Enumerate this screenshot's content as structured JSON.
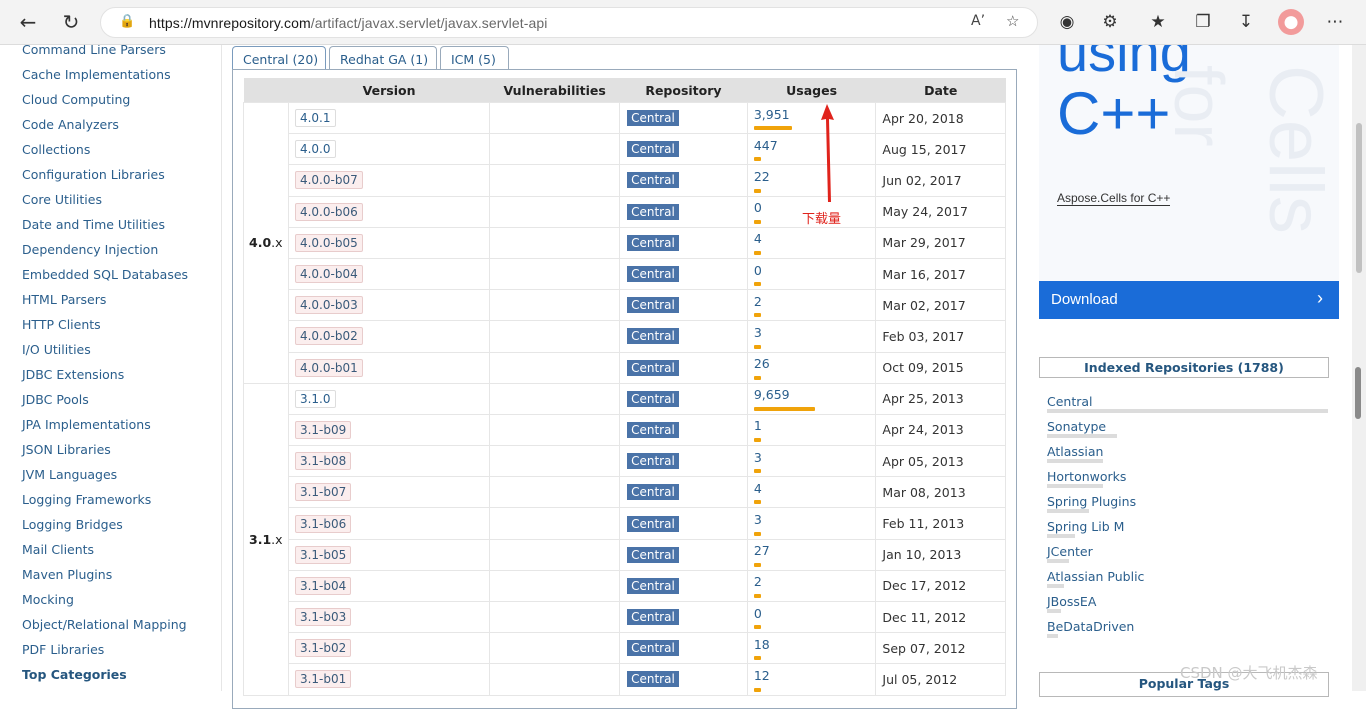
{
  "browser": {
    "url_host": "https://mvnrepository.com",
    "url_path": "/artifact/javax.servlet/javax.servlet-api"
  },
  "categories": [
    "Command Line Parsers",
    "Cache Implementations",
    "Cloud Computing",
    "Code Analyzers",
    "Collections",
    "Configuration Libraries",
    "Core Utilities",
    "Date and Time Utilities",
    "Dependency Injection",
    "Embedded SQL Databases",
    "HTML Parsers",
    "HTTP Clients",
    "I/O Utilities",
    "JDBC Extensions",
    "JDBC Pools",
    "JPA Implementations",
    "JSON Libraries",
    "JVM Languages",
    "Logging Frameworks",
    "Logging Bridges",
    "Mail Clients",
    "Maven Plugins",
    "Mocking",
    "Object/Relational Mapping",
    "PDF Libraries"
  ],
  "top_categories_label": "Top Categories",
  "tabs": [
    "Central (20)",
    "Redhat GA (1)",
    "ICM (5)"
  ],
  "table": {
    "headers": [
      "Version",
      "Vulnerabilities",
      "Repository",
      "Usages",
      "Date"
    ],
    "groups": [
      {
        "label_bold": "4.0",
        "label_rest": ".x",
        "rows": [
          {
            "version": "4.0.1",
            "pre": false,
            "repo": "Central",
            "usages": "3,951",
            "usage_frac": 0.32,
            "date": "Apr 20, 2018"
          },
          {
            "version": "4.0.0",
            "pre": false,
            "repo": "Central",
            "usages": "447",
            "usage_frac": 0.06,
            "date": "Aug 15, 2017"
          },
          {
            "version": "4.0.0-b07",
            "pre": true,
            "repo": "Central",
            "usages": "22",
            "usage_frac": 0.05,
            "date": "Jun 02, 2017"
          },
          {
            "version": "4.0.0-b06",
            "pre": true,
            "repo": "Central",
            "usages": "0",
            "usage_frac": 0.05,
            "date": "May 24, 2017"
          },
          {
            "version": "4.0.0-b05",
            "pre": true,
            "repo": "Central",
            "usages": "4",
            "usage_frac": 0.05,
            "date": "Mar 29, 2017"
          },
          {
            "version": "4.0.0-b04",
            "pre": true,
            "repo": "Central",
            "usages": "0",
            "usage_frac": 0.05,
            "date": "Mar 16, 2017"
          },
          {
            "version": "4.0.0-b03",
            "pre": true,
            "repo": "Central",
            "usages": "2",
            "usage_frac": 0.05,
            "date": "Mar 02, 2017"
          },
          {
            "version": "4.0.0-b02",
            "pre": true,
            "repo": "Central",
            "usages": "3",
            "usage_frac": 0.05,
            "date": "Feb 03, 2017"
          },
          {
            "version": "4.0.0-b01",
            "pre": true,
            "repo": "Central",
            "usages": "26",
            "usage_frac": 0.05,
            "date": "Oct 09, 2015"
          }
        ]
      },
      {
        "label_bold": "3.1",
        "label_rest": ".x",
        "rows": [
          {
            "version": "3.1.0",
            "pre": false,
            "repo": "Central",
            "usages": "9,659",
            "usage_frac": 0.51,
            "date": "Apr 25, 2013"
          },
          {
            "version": "3.1-b09",
            "pre": true,
            "repo": "Central",
            "usages": "1",
            "usage_frac": 0.05,
            "date": "Apr 24, 2013"
          },
          {
            "version": "3.1-b08",
            "pre": true,
            "repo": "Central",
            "usages": "3",
            "usage_frac": 0.05,
            "date": "Apr 05, 2013"
          },
          {
            "version": "3.1-b07",
            "pre": true,
            "repo": "Central",
            "usages": "4",
            "usage_frac": 0.05,
            "date": "Mar 08, 2013"
          },
          {
            "version": "3.1-b06",
            "pre": true,
            "repo": "Central",
            "usages": "3",
            "usage_frac": 0.05,
            "date": "Feb 11, 2013"
          },
          {
            "version": "3.1-b05",
            "pre": true,
            "repo": "Central",
            "usages": "27",
            "usage_frac": 0.05,
            "date": "Jan 10, 2013"
          },
          {
            "version": "3.1-b04",
            "pre": true,
            "repo": "Central",
            "usages": "2",
            "usage_frac": 0.05,
            "date": "Dec 17, 2012"
          },
          {
            "version": "3.1-b03",
            "pre": true,
            "repo": "Central",
            "usages": "0",
            "usage_frac": 0.05,
            "date": "Dec 11, 2012"
          },
          {
            "version": "3.1-b02",
            "pre": true,
            "repo": "Central",
            "usages": "18",
            "usage_frac": 0.05,
            "date": "Sep 07, 2012"
          },
          {
            "version": "3.1-b01",
            "pre": true,
            "repo": "Central",
            "usages": "12",
            "usage_frac": 0.05,
            "date": "Jul 05, 2012"
          }
        ]
      }
    ]
  },
  "annotation": {
    "label": "下载量",
    "color": "#e0231c"
  },
  "ad": {
    "big_text_1": "using",
    "big_text_2": "C++",
    "ghost_1": "for",
    "ghost_2": "Cells",
    "brand": "Aspose.Cells for C++",
    "button_label": "Download",
    "accent": "#1a6cd8"
  },
  "indexed_repos": {
    "title": "Indexed Repositories (1788)",
    "items": [
      {
        "name": "Central",
        "share": 1.0
      },
      {
        "name": "Sonatype",
        "share": 0.25
      },
      {
        "name": "Atlassian",
        "share": 0.2
      },
      {
        "name": "Hortonworks",
        "share": 0.2
      },
      {
        "name": "Spring Plugins",
        "share": 0.15
      },
      {
        "name": "Spring Lib M",
        "share": 0.1
      },
      {
        "name": "JCenter",
        "share": 0.08
      },
      {
        "name": "Atlassian Public",
        "share": 0.06
      },
      {
        "name": "JBossEA",
        "share": 0.05
      },
      {
        "name": "BeDataDriven",
        "share": 0.04
      }
    ]
  },
  "popular_tags_label": "Popular Tags",
  "watermark": "CSDN @大飞机杰森"
}
